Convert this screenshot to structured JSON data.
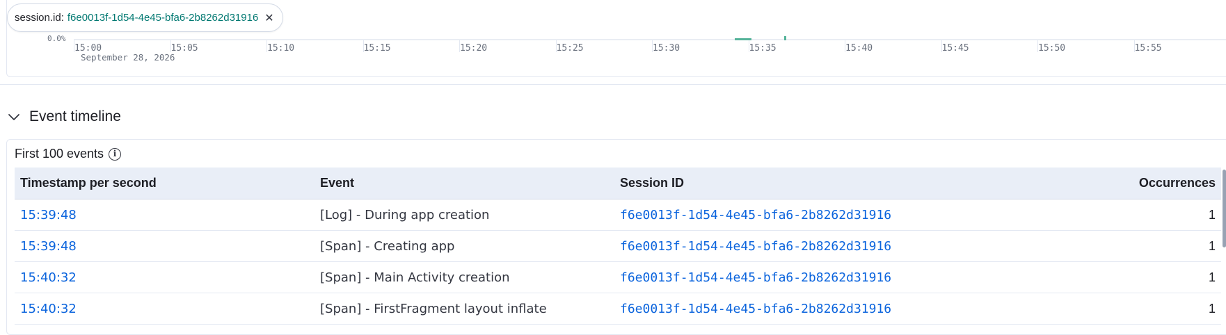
{
  "filter": {
    "key": "session.id:",
    "value": "f6e0013f-1d54-4e45-bfa6-2b8262d31916",
    "close_glyph": "✕"
  },
  "chart": {
    "y_tick": "0.0%",
    "x_ticks": [
      "15:00",
      "15:05",
      "15:10",
      "15:15",
      "15:20",
      "15:25",
      "15:30",
      "15:35",
      "15:40",
      "15:45",
      "15:50",
      "15:55"
    ],
    "date_label": "September 28, 2026",
    "series_color": "#54b399"
  },
  "chart_data": {
    "type": "bar",
    "categories": [
      "15:00",
      "15:05",
      "15:10",
      "15:15",
      "15:20",
      "15:25",
      "15:30",
      "15:35",
      "15:40",
      "15:45",
      "15:50",
      "15:55"
    ],
    "y_tick_labels": [
      "0.0%"
    ],
    "date_label": "September 28, 2026",
    "grid": false
  },
  "accordion": {
    "title": "Event timeline",
    "icon": "chevron-down-icon",
    "expanded": true
  },
  "events_panel": {
    "heading": "First 100 events",
    "info_icon": "info-icon",
    "columns": [
      "Timestamp per second",
      "Event",
      "Session ID",
      "Occurrences"
    ],
    "rows": [
      {
        "timestamp": "15:39:48",
        "event": "[Log] - During app creation",
        "session_id": "f6e0013f-1d54-4e45-bfa6-2b8262d31916",
        "occurrences": "1"
      },
      {
        "timestamp": "15:39:48",
        "event": "[Span] - Creating app",
        "session_id": "f6e0013f-1d54-4e45-bfa6-2b8262d31916",
        "occurrences": "1"
      },
      {
        "timestamp": "15:40:32",
        "event": "[Span] - Main Activity creation",
        "session_id": "f6e0013f-1d54-4e45-bfa6-2b8262d31916",
        "occurrences": "1"
      },
      {
        "timestamp": "15:40:32",
        "event": "[Span] - FirstFragment layout inflate",
        "session_id": "f6e0013f-1d54-4e45-bfa6-2b8262d31916",
        "occurrences": "1"
      }
    ]
  },
  "colors": {
    "link": "#0b64dd",
    "filter_value": "#007871",
    "header_bg": "#e9eef7",
    "accent_series": "#54b399"
  }
}
